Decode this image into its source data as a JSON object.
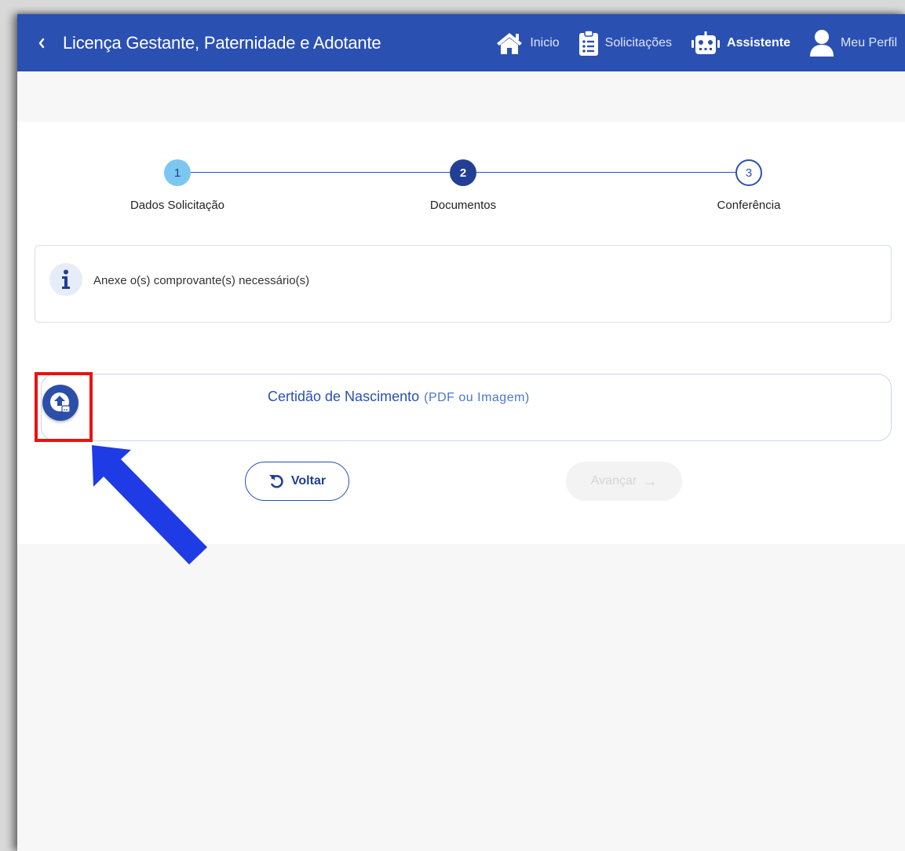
{
  "header": {
    "title": "Licença Gestante, Paternidade e Adotante",
    "nav": [
      {
        "label": "Inicio",
        "icon": "home-icon"
      },
      {
        "label": "Solicitações",
        "icon": "clipboard-list-icon"
      },
      {
        "label": "Assistente",
        "icon": "robot-icon"
      },
      {
        "label": "Meu Perfil",
        "icon": "user-icon"
      }
    ]
  },
  "stepper": {
    "steps": [
      {
        "number": "1",
        "label": "Dados Solicitação",
        "state": "done"
      },
      {
        "number": "2",
        "label": "Documentos",
        "state": "active"
      },
      {
        "number": "3",
        "label": "Conferência",
        "state": "todo"
      }
    ]
  },
  "info": {
    "text": "Anexe o(s) comprovante(s) necessário(s)",
    "icon": "info-icon"
  },
  "upload": {
    "title": "Certidão de Nascimento",
    "hint": "(PDF ou Imagem)",
    "icon": "upload-icon"
  },
  "actions": {
    "back_label": "Voltar",
    "next_label": "Avançar"
  },
  "colors": {
    "primary": "#2a50b2",
    "step_done": "#7cc6f2",
    "annotation_red": "#e8130f",
    "annotation_arrow": "#1f3be6"
  }
}
